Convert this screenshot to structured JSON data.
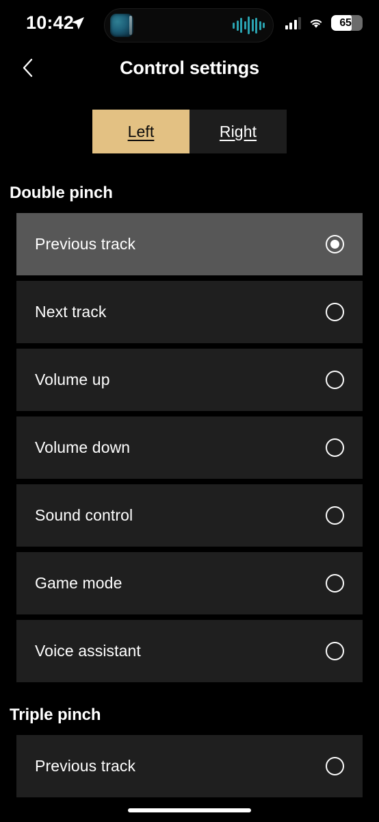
{
  "status_bar": {
    "time": "10:42",
    "location_icon": "location-arrow-icon",
    "dynamic_island": {
      "album_art_icon": "album-art-thumbnail",
      "waveform_icon": "audio-waveform-icon",
      "waveform_color": "#2aa3b0"
    },
    "cellular_icon": "cellular-signal-icon",
    "wifi_icon": "wifi-icon",
    "battery": {
      "percent": "65",
      "level": 65,
      "icon": "battery-icon"
    }
  },
  "nav": {
    "back_icon": "chevron-left-icon",
    "title": "Control settings"
  },
  "segmented_control": {
    "selected": "Left",
    "options": [
      {
        "label": "Left",
        "active": true
      },
      {
        "label": "Right",
        "active": false
      }
    ],
    "active_background": "#e3c183",
    "inactive_background": "#1d1d1d"
  },
  "sections": [
    {
      "title": "Double pinch",
      "items": [
        {
          "label": "Previous track",
          "selected": true
        },
        {
          "label": "Next track",
          "selected": false
        },
        {
          "label": "Volume up",
          "selected": false
        },
        {
          "label": "Volume down",
          "selected": false
        },
        {
          "label": "Sound control",
          "selected": false
        },
        {
          "label": "Game mode",
          "selected": false
        },
        {
          "label": "Voice assistant",
          "selected": false
        }
      ]
    },
    {
      "title": "Triple pinch",
      "items": [
        {
          "label": "Previous track",
          "selected": false
        }
      ]
    }
  ],
  "home_indicator": "home-indicator"
}
